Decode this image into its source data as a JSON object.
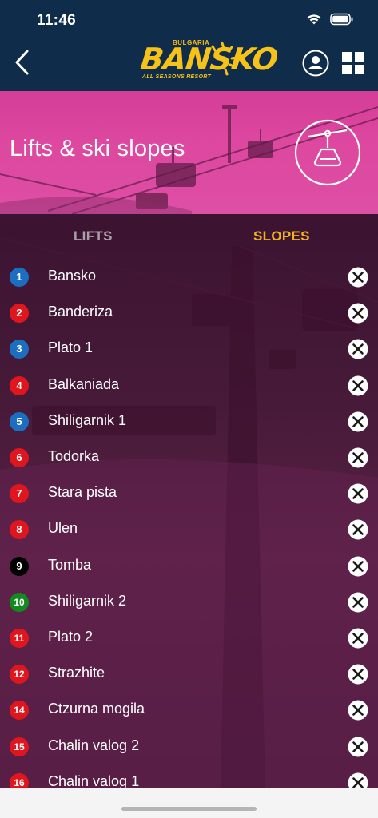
{
  "status": {
    "time": "11:46"
  },
  "header": {
    "logo_top": "BULGARIA",
    "logo_main": "BANSKO",
    "logo_sub": "ALL SEASONS RESORT"
  },
  "hero": {
    "title": "Lifts & ski slopes"
  },
  "tabs": {
    "lifts": "LIFTS",
    "slopes": "SLOPES",
    "active": "slopes"
  },
  "colors": {
    "blue": "#1c6fc0",
    "red": "#e0161e",
    "black": "#000000",
    "green": "#138a1f",
    "accent": "#f1b21a",
    "header_bg": "#0f2d4a"
  },
  "slopes": [
    {
      "num": "1",
      "name": "Bansko",
      "color": "#1c6fc0"
    },
    {
      "num": "2",
      "name": "Banderiza",
      "color": "#e0161e"
    },
    {
      "num": "3",
      "name": "Plato 1",
      "color": "#1c6fc0"
    },
    {
      "num": "4",
      "name": "Balkaniada",
      "color": "#e0161e"
    },
    {
      "num": "5",
      "name": "Shiligarnik 1",
      "color": "#1c6fc0"
    },
    {
      "num": "6",
      "name": "Todorka",
      "color": "#e0161e"
    },
    {
      "num": "7",
      "name": "Stara pista",
      "color": "#e0161e"
    },
    {
      "num": "8",
      "name": "Ulen",
      "color": "#e0161e"
    },
    {
      "num": "9",
      "name": "Tomba",
      "color": "#000000"
    },
    {
      "num": "10",
      "name": "Shiligarnik 2",
      "color": "#138a1f"
    },
    {
      "num": "11",
      "name": "Plato 2",
      "color": "#e0161e"
    },
    {
      "num": "12",
      "name": "Strazhite",
      "color": "#e0161e"
    },
    {
      "num": "14",
      "name": "Ctzurna mogila",
      "color": "#e0161e"
    },
    {
      "num": "15",
      "name": "Chalin valog 2",
      "color": "#e0161e"
    },
    {
      "num": "16",
      "name": "Chalin valog 1",
      "color": "#e0161e"
    }
  ]
}
